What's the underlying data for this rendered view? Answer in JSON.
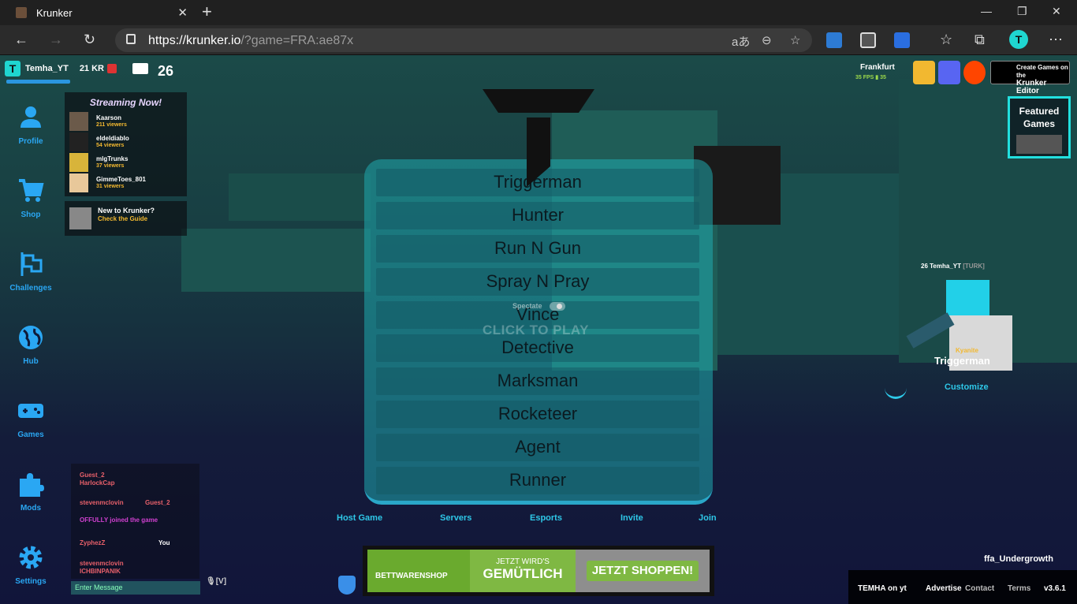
{
  "browser": {
    "tab_title": "Krunker",
    "url_main": "https://krunker.io",
    "url_rest": "/?game=FRA:ae87x",
    "profile_initial": "T"
  },
  "hud": {
    "username": "Temha_YT",
    "kr": "21 KR",
    "level": "26"
  },
  "sidebar": {
    "items": [
      {
        "label": "Profile",
        "icon": "profile-icon"
      },
      {
        "label": "Shop",
        "icon": "cart-icon"
      },
      {
        "label": "Challenges",
        "icon": "flag-icon"
      },
      {
        "label": "Hub",
        "icon": "globe-icon"
      },
      {
        "label": "Games",
        "icon": "gamepad-icon"
      },
      {
        "label": "Mods",
        "icon": "puzzle-icon"
      },
      {
        "label": "Settings",
        "icon": "gear-icon"
      }
    ]
  },
  "streaming": {
    "title": "Streaming Now!",
    "streamers": [
      {
        "name": "Kaarson",
        "viewers": "211 viewers"
      },
      {
        "name": "eldeldiablo",
        "viewers": "54 viewers"
      },
      {
        "name": "mlgTrunks",
        "viewers": "37 viewers"
      },
      {
        "name": "GimmeToes_801",
        "viewers": "31 viewers"
      }
    ],
    "guide_title": "New to Krunker?",
    "guide_link": "Check the Guide"
  },
  "classes": [
    "Triggerman",
    "Hunter",
    "Run N Gun",
    "Spray N Pray",
    "Vince",
    "Detective",
    "Marksman",
    "Rocketeer",
    "Agent",
    "Runner"
  ],
  "play": {
    "spectate": "Spectate",
    "click_to_play": "CLICK TO PLAY"
  },
  "bottom_links": [
    "Host Game",
    "Servers",
    "Esports",
    "Invite",
    "Join"
  ],
  "chat": {
    "lines": [
      {
        "a": "Guest_2",
        "b": "HarlockCap",
        "color": "#e8606a"
      },
      {
        "a": "stevenmclovin",
        "b": "Guest_2",
        "color": "#e8606a"
      },
      {
        "a": "OFFULLY joined the game",
        "color": "#d040d0"
      },
      {
        "a": "ZyphezZ",
        "b": "You",
        "color": "#e8606a"
      },
      {
        "a": "stevenmclovin",
        "b": "ICHBINPANIK",
        "color": "#e8606a"
      }
    ],
    "placeholder": "Enter Message",
    "mic_hint": "[V]"
  },
  "server": {
    "name": "Frankfurt",
    "fps": "35 FPS",
    "ping": "35"
  },
  "editor_button": {
    "line1": "Create Games on the",
    "line2": "Krunker Editor"
  },
  "featured": {
    "title": "Featured Games"
  },
  "player": {
    "level": "26",
    "name": "Temha_YT",
    "clan": "[TURK]",
    "skin": "Kyanite",
    "class": "Triggerman",
    "customize": "Customize"
  },
  "map_name": "ffa_Undergrowth",
  "footer": {
    "creator": "TEMHA on yt",
    "advertise": "Advertise",
    "contact": "Contact",
    "terms": "Terms",
    "version": "v3.6.1"
  },
  "ad": {
    "shop": "BETTWARENSHOP",
    "line1": "JETZT WIRD'S",
    "line2": "GEMÜTLICH",
    "cta": "JETZT SHOPPEN!"
  },
  "colors": {
    "accent": "#2aa7f3",
    "teal": "#1fd6d0",
    "gold": "#f2b830"
  }
}
